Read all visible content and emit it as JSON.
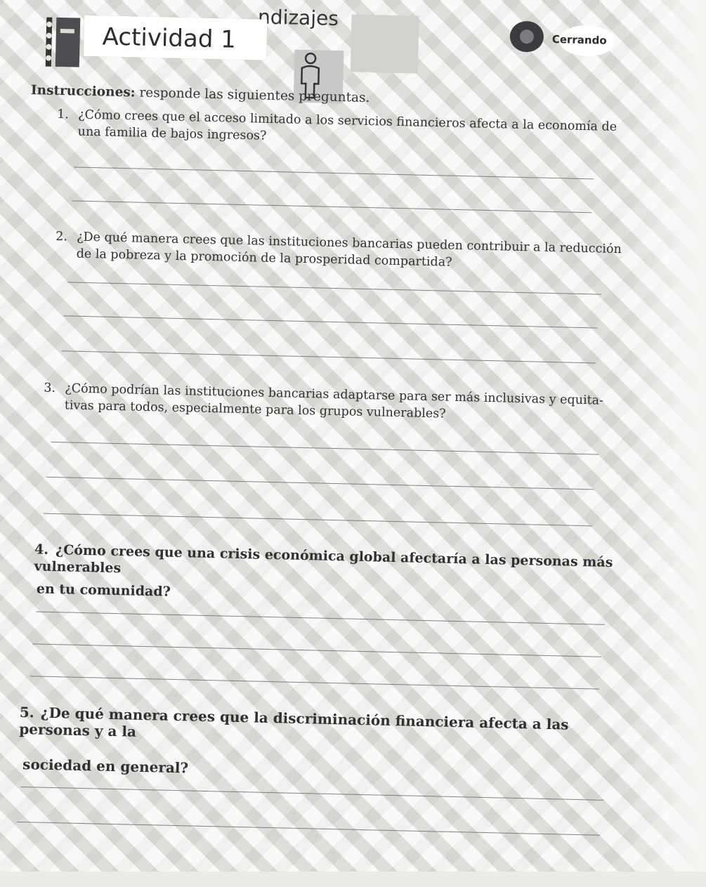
{
  "header": {
    "section_label": "...ndizajes",
    "title": "Actividad 1",
    "badge": "Cerrando"
  },
  "instructions": {
    "lead": "Instrucciones:",
    "text": "responde las siguientes preguntas."
  },
  "questions": [
    {
      "number": "1.",
      "line1": "¿Cómo crees que el acceso limitado a los servicios financieros afecta a la economía de",
      "line2": "una familia de bajos ingresos?"
    },
    {
      "number": "2.",
      "line1": "¿De qué manera crees que las instituciones bancarias pueden contribuir a la reducción",
      "line2": "de la pobreza y la promoción de la prosperidad compartida?"
    },
    {
      "number": "3.",
      "line1": "¿Cómo podrían las instituciones bancarias adaptarse para ser más inclusivas y equita-",
      "line2": "tivas para todos, especialmente para los grupos vulnerables?"
    },
    {
      "number": "4.",
      "line1": "¿Cómo crees que una crisis económica global afectaría a las personas más vulnerables",
      "line2": "en tu comunidad?"
    },
    {
      "number": "5.",
      "line1": "¿De qué manera crees que la discriminación financiera afecta a las personas y a la",
      "line2": "sociedad en general?"
    }
  ]
}
